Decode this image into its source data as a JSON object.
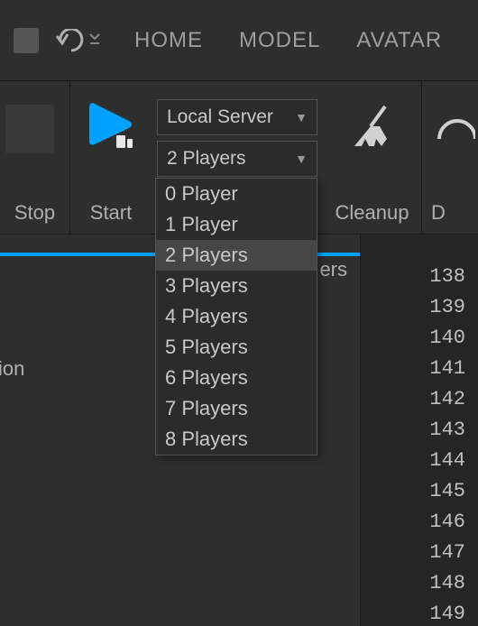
{
  "topbar": {
    "tabs": [
      "HOME",
      "MODEL",
      "AVATAR"
    ]
  },
  "ribbon": {
    "stop_label": "Stop",
    "start_label": "Start",
    "server_combo": "Local Server",
    "players_combo": "2 Players",
    "cleanup_label": "Cleanup",
    "truncated_label": "D"
  },
  "dropdown": {
    "items": [
      "0 Player",
      "1 Player",
      "2 Players",
      "3 Players",
      "4 Players",
      "5 Players",
      "6 Players",
      "7 Players",
      "8 Players"
    ],
    "hover_index": 2
  },
  "workspace": {
    "panel_label_right": "ers",
    "panel_text_left": "ion",
    "line_numbers": [
      "138",
      "139",
      "140",
      "141",
      "142",
      "143",
      "144",
      "145",
      "146",
      "147",
      "148",
      "149"
    ]
  }
}
